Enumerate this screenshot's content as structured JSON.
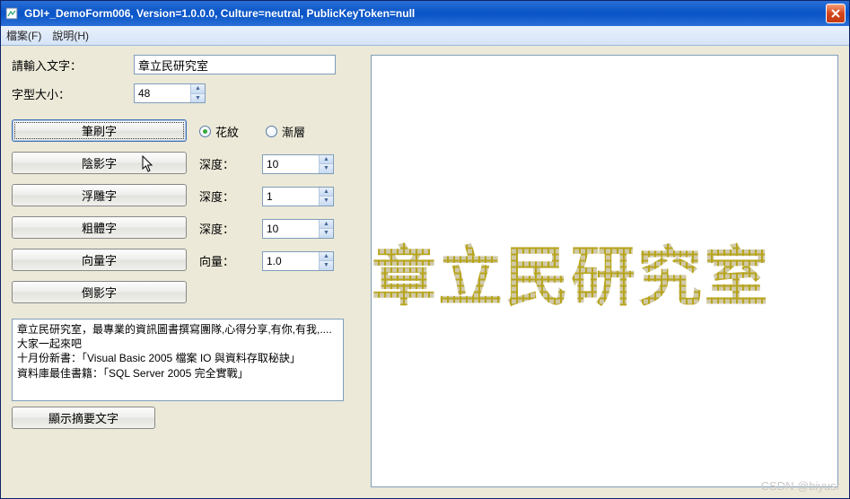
{
  "window": {
    "title": "GDI+_DemoForm006, Version=1.0.0.0, Culture=neutral, PublicKeyToken=null"
  },
  "menu": {
    "file": "檔案(F)",
    "help": "說明(H)"
  },
  "labels": {
    "input_text": "請輸入文字：",
    "font_size": "字型大小："
  },
  "inputs": {
    "text_value": "章立民研究室",
    "font_size_value": "48"
  },
  "buttons": {
    "brush": "筆刷字",
    "shadow": "陰影字",
    "emboss": "浮雕字",
    "bold": "粗體字",
    "vector": "向量字",
    "mirror": "倒影字",
    "show_summary": "顯示摘要文字"
  },
  "radios": {
    "pattern": "花紋",
    "gradient": "漸層",
    "selected": "pattern"
  },
  "params": {
    "depth_label": "深度：",
    "vector_label": "向量：",
    "shadow_depth": "10",
    "emboss_depth": "1",
    "bold_depth": "10",
    "vector_value": "1.0"
  },
  "summary_text": "章立民研究室，最專業的資訊圖書撰寫團隊,心得分享,有你,有我,....大家一起來吧\n十月份新書：「Visual Basic 2005 檔案 IO 與資料存取秘訣」\n資料庫最佳書籍：「SQL Server 2005 完全實戰」",
  "canvas_text": "章立民研究室",
  "watermark": "CSDN @biyusr"
}
